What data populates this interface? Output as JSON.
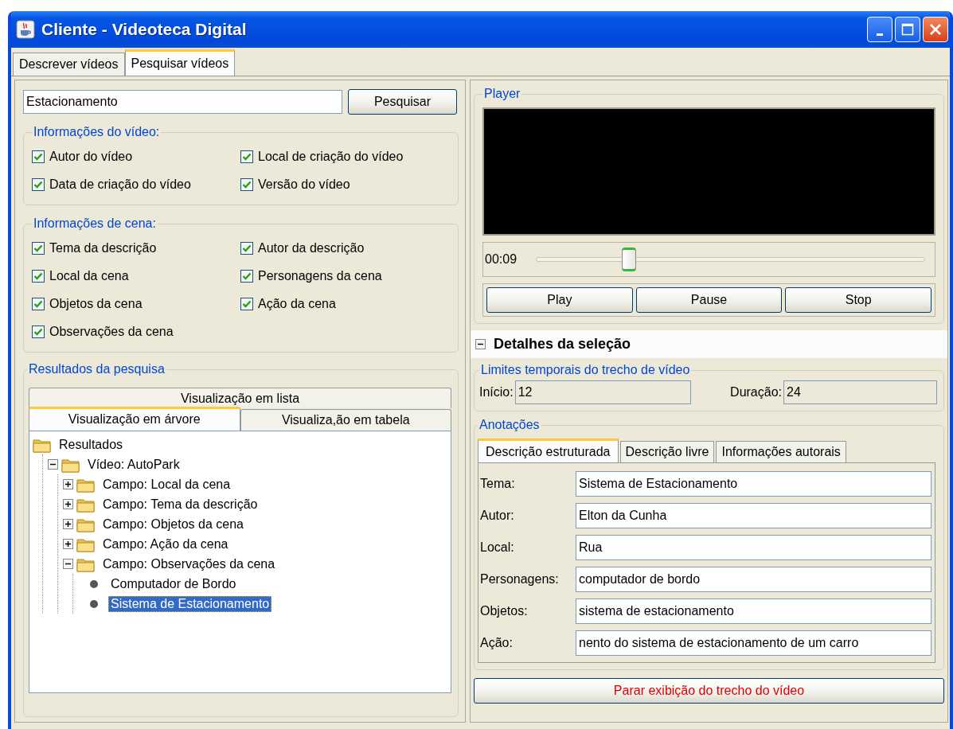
{
  "window": {
    "title": "Cliente - Videoteca Digital"
  },
  "tabs": [
    {
      "label": "Descrever vídeos",
      "selected": false
    },
    {
      "label": "Pesquisar vídeos",
      "selected": true
    }
  ],
  "search": {
    "value": "Estacionamento",
    "button": "Pesquisar"
  },
  "video_info": {
    "title": "Informações do vídeo:",
    "options": [
      {
        "label": "Autor do vídeo",
        "checked": true
      },
      {
        "label": "Local de criação do vídeo",
        "checked": true
      },
      {
        "label": "Data de criação do vídeo",
        "checked": true
      },
      {
        "label": "Versão do vídeo",
        "checked": true
      }
    ]
  },
  "scene_info": {
    "title": "Informações de cena:",
    "options": [
      {
        "label": "Tema da descrição",
        "checked": true
      },
      {
        "label": "Autor da descrição",
        "checked": true
      },
      {
        "label": "Local da cena",
        "checked": true
      },
      {
        "label": "Personagens da cena",
        "checked": true
      },
      {
        "label": "Objetos da cena",
        "checked": true
      },
      {
        "label": "Ação da cena",
        "checked": true
      },
      {
        "label": "Observações da cena",
        "checked": true
      }
    ]
  },
  "results": {
    "title": "Resultados da pesquisa",
    "tabs": [
      {
        "label": "Visualização em lista",
        "kind": "back",
        "selected": false
      },
      {
        "label": "Visualização em árvore",
        "kind": "front",
        "selected": true
      },
      {
        "label": "Visualiza,ão em tabela",
        "kind": "front",
        "selected": false
      }
    ],
    "tree": [
      {
        "label": "Resultados",
        "kind": "folder",
        "selected": false,
        "children": [
          {
            "label": "Vídeo: AutoPark",
            "kind": "folder",
            "expanded": true,
            "selected": false,
            "children": [
              {
                "label": "Campo: Local da cena",
                "kind": "folder",
                "expanded": false,
                "selected": false
              },
              {
                "label": "Campo: Tema da descrição",
                "kind": "folder",
                "expanded": false,
                "selected": false
              },
              {
                "label": "Campo: Objetos da cena",
                "kind": "folder",
                "expanded": false,
                "selected": false
              },
              {
                "label": "Campo: Ação da cena",
                "kind": "folder",
                "expanded": false,
                "selected": false
              },
              {
                "label": "Campo: Observações da cena",
                "kind": "folder",
                "expanded": true,
                "selected": false,
                "children": [
                  {
                    "label": "Computador de Bordo",
                    "kind": "leaf",
                    "selected": false
                  },
                  {
                    "label": "Sistema de Estacionamento",
                    "kind": "leaf",
                    "selected": true
                  }
                ]
              }
            ]
          }
        ]
      }
    ]
  },
  "player": {
    "title": "Player",
    "time": "00:09",
    "level": 0.24,
    "buttons": [
      "Play",
      "Pause",
      "Stop"
    ]
  },
  "details": {
    "title": "Detalhes da seleção",
    "expanded": true
  },
  "limits": {
    "title": "Limites temporais do trecho de vídeo",
    "editable": false,
    "fields": [
      {
        "label": "Início:",
        "value": "12"
      },
      {
        "label": "Duração:",
        "value": "24"
      }
    ]
  },
  "annotations": {
    "title": "Anotações",
    "tabs": [
      {
        "label": "Descrição estruturada",
        "selected": true
      },
      {
        "label": "Descrição livre",
        "selected": false
      },
      {
        "label": "Informações autorais",
        "selected": false
      }
    ],
    "fields": [
      {
        "label": "Tema:",
        "value": "Sistema de Estacionamento"
      },
      {
        "label": "Autor:",
        "value": "Elton da Cunha"
      },
      {
        "label": "Local:",
        "value": "Rua"
      },
      {
        "label": "Personagens:",
        "value": "computador de bordo"
      },
      {
        "label": "Objetos:",
        "value": "sistema de estacionamento"
      },
      {
        "label": "Ação:",
        "value": "nento do sistema de estacionamento de um carro"
      }
    ]
  },
  "stop_button": "Parar exibição do trecho do vídeo"
}
